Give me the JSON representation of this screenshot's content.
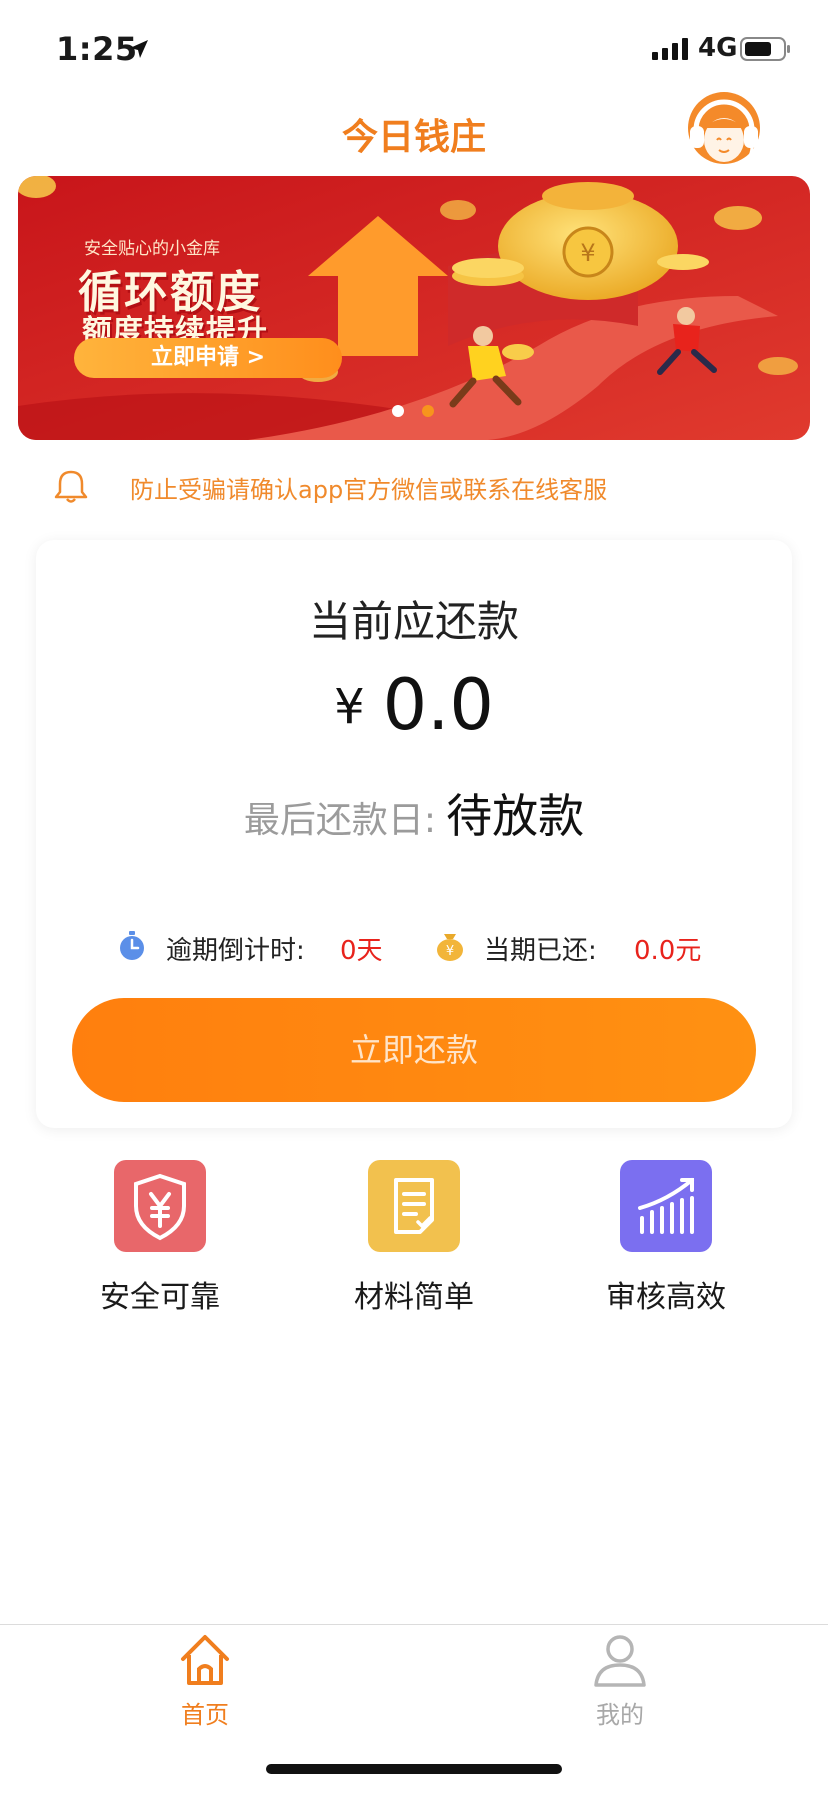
{
  "status_bar": {
    "time": "1:25",
    "network": "4G"
  },
  "header": {
    "title": "今日钱庄"
  },
  "banner": {
    "subtitle": "安全贴心的小金库",
    "title": "循环额度",
    "title2": "额度持续提升",
    "button": "立即申请 >",
    "slide_count": 2,
    "active_slide": 2
  },
  "notice": {
    "text": "防止受骗请确认app官方微信或联系在线客服"
  },
  "repayment": {
    "title": "当前应还款",
    "currency": "¥",
    "amount": "0.0",
    "last_day_label": "最后还款日:",
    "last_day_value": "待放款",
    "overdue_label": "逾期倒计时:",
    "overdue_value": "0天",
    "paid_label": "当期已还:",
    "paid_value": "0.0元",
    "button": "立即还款"
  },
  "features": [
    {
      "label": "安全可靠",
      "icon": "shield-yen-icon",
      "color": "#e8676a"
    },
    {
      "label": "材料简单",
      "icon": "document-icon",
      "color": "#f2c14e"
    },
    {
      "label": "审核高效",
      "icon": "bar-chart-icon",
      "color": "#7b6ff0"
    }
  ],
  "tabs": [
    {
      "label": "首页",
      "icon": "home-icon",
      "active": true
    },
    {
      "label": "我的",
      "icon": "user-icon",
      "active": false
    }
  ],
  "colors": {
    "accent": "#f07e1e",
    "alert": "#e8231c",
    "banner_red": "#d9252a"
  }
}
